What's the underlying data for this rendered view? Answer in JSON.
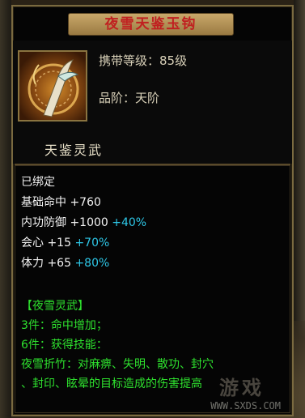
{
  "item": {
    "name": "夜雪天鉴玉钩",
    "level_line": "携带等级：85级",
    "grade_line": "品阶：天阶",
    "subtype": "天鉴灵武"
  },
  "status": {
    "bound": "已绑定"
  },
  "attributes": [
    {
      "name": "基础命中",
      "base": "+760",
      "bonus": ""
    },
    {
      "name": "内功防御",
      "base": "+1000",
      "bonus": "+40%"
    },
    {
      "name": "会心",
      "base": "+15",
      "bonus": "+70%"
    },
    {
      "name": "体力",
      "base": "+65",
      "bonus": "+80%"
    }
  ],
  "set": {
    "title": "【夜雪灵武】",
    "tier3": "3件：命中增加；",
    "tier6": "6件：获得技能：",
    "skill_line1": "夜雪折竹：对麻痹、失明、散功、封穴",
    "skill_line2": "、封印、眩晕的目标造成的伤害提高"
  },
  "watermark": {
    "logo": "游戏",
    "url": "WWW.SXDS.COM"
  },
  "colors": {
    "title_red": "#c02020",
    "cyan_bonus": "#2ec8e8",
    "green_set": "#2ee02e",
    "frame_gold": "#7a6a40"
  }
}
